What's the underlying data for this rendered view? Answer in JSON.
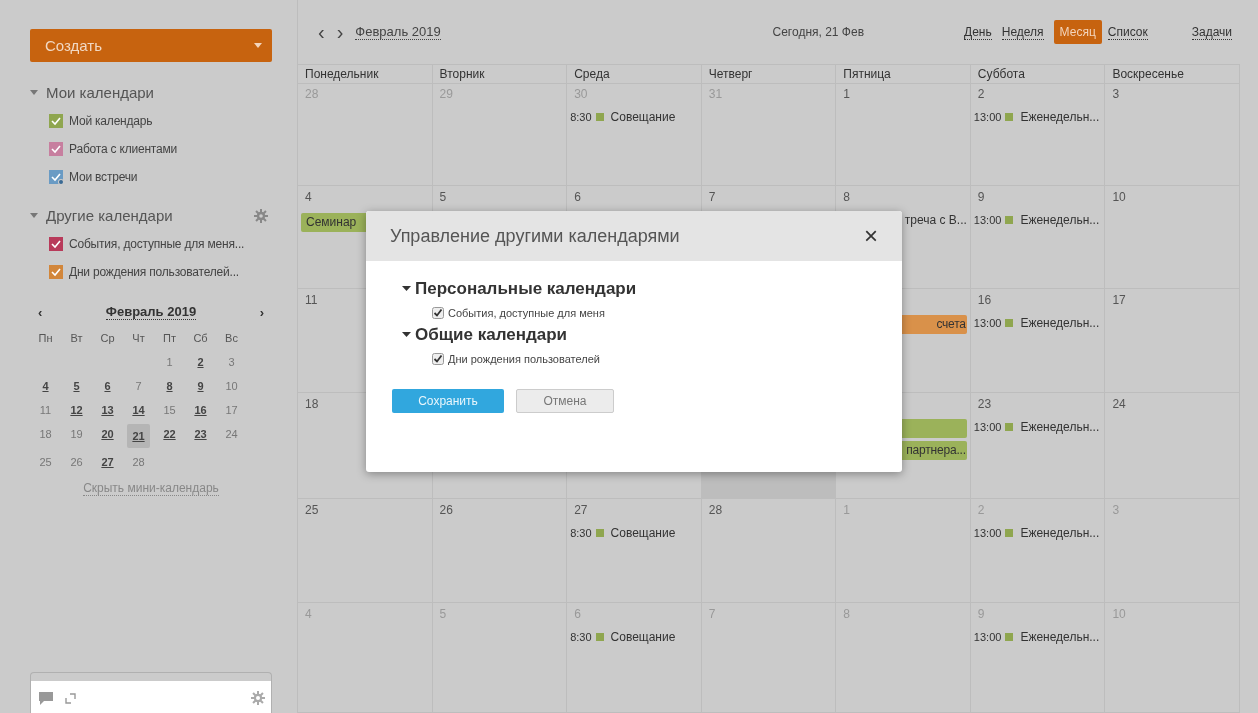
{
  "sidebar": {
    "create_button": "Создать",
    "groups": [
      {
        "title": "Мои календари",
        "expanded": true,
        "gear": false,
        "items": [
          {
            "label": "Мой календарь",
            "color": "#8fa64f",
            "checked": true,
            "kind": "own"
          },
          {
            "label": "Работа с клиентами",
            "color": "#c77f9f",
            "checked": true,
            "kind": "own"
          },
          {
            "label": "Мои встречи",
            "color": "#6a9bc4",
            "checked": true,
            "kind": "shared"
          }
        ]
      },
      {
        "title": "Другие календари",
        "expanded": true,
        "gear": true,
        "items": [
          {
            "label": "События, доступные для меня...",
            "color": "#b83a5a",
            "checked": true,
            "kind": "own"
          },
          {
            "label": "Дни рождения пользователей...",
            "color": "#d2863a",
            "checked": true,
            "kind": "own"
          }
        ]
      }
    ],
    "mini_calendar": {
      "title": "Февраль 2019",
      "prev": "‹",
      "next": "›",
      "weekdays": [
        "Пн",
        "Вт",
        "Ср",
        "Чт",
        "Пт",
        "Сб",
        "Вс"
      ],
      "weeks": [
        {
          "days": [
            {
              "day": "1",
              "has_events": false,
              "selected": false
            },
            {
              "day": "2",
              "has_events": true,
              "selected": false
            },
            {
              "day": "3",
              "has_events": false,
              "selected": false
            }
          ]
        },
        {
          "days": [
            {
              "day": "4",
              "has_events": true,
              "selected": false
            },
            {
              "day": "5",
              "has_events": true,
              "selected": false
            },
            {
              "day": "6",
              "has_events": true,
              "selected": false
            },
            {
              "day": "7",
              "has_events": false,
              "selected": false
            },
            {
              "day": "8",
              "has_events": true,
              "selected": false
            },
            {
              "day": "9",
              "has_events": true,
              "selected": false
            },
            {
              "day": "10",
              "has_events": false,
              "selected": false
            }
          ]
        },
        {
          "days": [
            {
              "day": "11",
              "has_events": false,
              "selected": false
            },
            {
              "day": "12",
              "has_events": true,
              "selected": false
            },
            {
              "day": "13",
              "has_events": true,
              "selected": false
            },
            {
              "day": "14",
              "has_events": true,
              "selected": false
            },
            {
              "day": "15",
              "has_events": false,
              "selected": false
            },
            {
              "day": "16",
              "has_events": true,
              "selected": false
            },
            {
              "day": "17",
              "has_events": false,
              "selected": false
            }
          ]
        },
        {
          "days": [
            {
              "day": "18",
              "has_events": false,
              "selected": false
            },
            {
              "day": "19",
              "has_events": false,
              "selected": false
            },
            {
              "day": "20",
              "has_events": true,
              "selected": false
            },
            {
              "day": "21",
              "has_events": true,
              "selected": true
            },
            {
              "day": "22",
              "has_events": true,
              "selected": false
            },
            {
              "day": "23",
              "has_events": true,
              "selected": false
            },
            {
              "day": "24",
              "has_events": false,
              "selected": false
            }
          ]
        },
        {
          "days": [
            {
              "day": "25",
              "has_events": false,
              "selected": false
            },
            {
              "day": "26",
              "has_events": false,
              "selected": false
            },
            {
              "day": "27",
              "has_events": true,
              "selected": false
            },
            {
              "day": "28",
              "has_events": false,
              "selected": false
            }
          ]
        }
      ],
      "hide_link": "Скрыть мини-календарь"
    }
  },
  "toolbar": {
    "prev": "‹",
    "next": "›",
    "month": "Февраль 2019",
    "today": "Сегодня, 21 Фев",
    "views": [
      {
        "label": "День",
        "selected": false
      },
      {
        "label": "Неделя",
        "selected": false
      },
      {
        "label": "Месяц",
        "selected": true
      },
      {
        "label": "Список",
        "selected": false
      }
    ],
    "tasks": "Задачи"
  },
  "calendar": {
    "columns": [
      "Понедельник",
      "Вторник",
      "Среда",
      "Четверг",
      "Пятница",
      "Суббота",
      "Воскресенье"
    ],
    "weeks": [
      [
        {
          "date": "28",
          "other_month": true,
          "today": false
        },
        {
          "date": "29",
          "other_month": true,
          "today": false
        },
        {
          "date": "30",
          "other_month": true,
          "today": false,
          "events": [
            {
              "kind": "timed",
              "time": "8:30",
              "title": "Совещание",
              "color": "#8fa64f"
            }
          ]
        },
        {
          "date": "31",
          "other_month": true,
          "today": false
        },
        {
          "date": "1",
          "other_month": false,
          "today": false
        },
        {
          "date": "2",
          "other_month": false,
          "today": false,
          "events": [
            {
              "kind": "timed",
              "time": "13:00",
              "title": "Еженедельн...",
              "color": "#8fa64f"
            }
          ]
        },
        {
          "date": "3",
          "other_month": false,
          "today": false
        }
      ],
      [
        {
          "date": "4",
          "other_month": false,
          "today": false,
          "events": [
            {
              "kind": "bar",
              "title": "Семинар",
              "color": "#9bb25a"
            }
          ]
        },
        {
          "date": "5",
          "other_month": false,
          "today": false
        },
        {
          "date": "6",
          "other_month": false,
          "today": false
        },
        {
          "date": "7",
          "other_month": false,
          "today": false
        },
        {
          "date": "8",
          "other_month": false,
          "today": false,
          "events": [
            {
              "kind": "tail",
              "title": "треча с В..."
            }
          ]
        },
        {
          "date": "9",
          "other_month": false,
          "today": false,
          "events": [
            {
              "kind": "timed",
              "time": "13:00",
              "title": "Еженедельн...",
              "color": "#8fa64f"
            }
          ]
        },
        {
          "date": "10",
          "other_month": false,
          "today": false
        }
      ],
      [
        {
          "date": "11",
          "other_month": false,
          "today": false
        },
        {
          "today": false,
          "events": [
            {
              "kind": "tail_bar",
              "title": "счета",
              "color": "#d9914a"
            }
          ]
        },
        {
          "date": "16",
          "other_month": false,
          "today": false,
          "events": [
            {
              "kind": "timed",
              "time": "13:00",
              "title": "Еженедельн...",
              "color": "#8fa64f"
            }
          ]
        },
        {
          "date": "17",
          "other_month": false,
          "today": false
        }
      ],
      [
        {
          "date": "18",
          "other_month": false,
          "today": false
        },
        {
          "today": false
        },
        {
          "today": false
        },
        {
          "today": true
        },
        {
          "today": false,
          "events": [
            {
              "kind": "tail_bar",
              "color": "#9bb25a"
            },
            {
              "kind": "tail_bar",
              "title": "партнера...",
              "color": "#9bb25a"
            }
          ]
        },
        {
          "date": "23",
          "other_month": false,
          "today": false,
          "events": [
            {
              "kind": "timed",
              "time": "13:00",
              "title": "Еженедельн...",
              "color": "#8fa64f"
            }
          ]
        },
        {
          "date": "24",
          "other_month": false,
          "today": false
        }
      ],
      [
        {
          "date": "25",
          "other_month": false,
          "today": false
        },
        {
          "date": "26",
          "other_month": false,
          "today": false
        },
        {
          "date": "27",
          "other_month": false,
          "today": false,
          "events": [
            {
              "kind": "timed",
              "time": "8:30",
              "title": "Совещание",
              "color": "#8fa64f"
            }
          ]
        },
        {
          "date": "28",
          "other_month": false,
          "today": false
        },
        {
          "date": "1",
          "other_month": true,
          "today": false
        },
        {
          "date": "2",
          "other_month": true,
          "today": false,
          "events": [
            {
              "kind": "timed",
              "time": "13:00",
              "title": "Еженедельн...",
              "color": "#8fa64f"
            }
          ]
        },
        {
          "date": "3",
          "other_month": true,
          "today": false
        }
      ],
      [
        {
          "date": "4",
          "other_month": true,
          "today": false
        },
        {
          "date": "5",
          "other_month": true,
          "today": false
        },
        {
          "date": "6",
          "other_month": true,
          "today": false,
          "events": [
            {
              "kind": "timed",
              "time": "8:30",
              "title": "Совещание",
              "color": "#8fa64f"
            }
          ]
        },
        {
          "date": "7",
          "other_month": true,
          "today": false
        },
        {
          "date": "8",
          "other_month": true,
          "today": false
        },
        {
          "date": "9",
          "other_month": true,
          "today": false,
          "events": [
            {
              "kind": "timed",
              "time": "13:00",
              "title": "Еженедельн...",
              "color": "#8fa64f"
            }
          ]
        },
        {
          "date": "10",
          "other_month": true,
          "today": false
        }
      ]
    ]
  },
  "dialog": {
    "title": "Управление другими календарями",
    "close": "×",
    "sections": [
      {
        "title": "Персональные календари",
        "expanded": true,
        "items": [
          {
            "label": "События, доступные для меня",
            "checked": true
          }
        ]
      },
      {
        "title": "Общие календари",
        "expanded": true,
        "items": [
          {
            "label": "Дни рождения пользователей",
            "checked": true
          }
        ]
      }
    ],
    "save": "Сохранить",
    "cancel": "Отмена"
  }
}
